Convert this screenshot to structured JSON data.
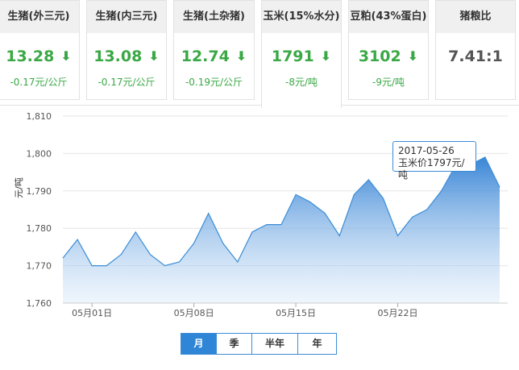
{
  "cards": [
    {
      "name": "生猪(外三元)",
      "value": "13.28",
      "direction": "down",
      "change": "-0.17元/公斤"
    },
    {
      "name": "生猪(内三元)",
      "value": "13.08",
      "direction": "down",
      "change": "-0.17元/公斤"
    },
    {
      "name": "生猪(土杂猪)",
      "value": "12.74",
      "direction": "down",
      "change": "-0.19元/公斤"
    },
    {
      "name": "玉米(15%水分)",
      "value": "1791",
      "direction": "down",
      "change": "-8元/吨"
    },
    {
      "name": "豆粕(43%蛋白)",
      "value": "3102",
      "direction": "down",
      "change": "-9元/吨"
    },
    {
      "name": "猪粮比",
      "value": "7.41:1",
      "direction": "none",
      "change": ""
    }
  ],
  "active_card": 3,
  "arrow_glyph": "⬇",
  "colors": {
    "down": "#3aa845",
    "line": "#3b8dd6",
    "tab_active": "#2f86d6"
  },
  "tooltip": {
    "date": "2017-05-26",
    "text": "玉米价1797元/吨"
  },
  "period_tabs": [
    {
      "label": "月",
      "active": true
    },
    {
      "label": "季",
      "active": false
    },
    {
      "label": "半年",
      "active": false
    },
    {
      "label": "年",
      "active": false
    }
  ],
  "chart_data": {
    "type": "area",
    "ylabel": "元/吨",
    "ylim": [
      1760,
      1810
    ],
    "yticks": [
      "1,760",
      "1,770",
      "1,780",
      "1,790",
      "1,800",
      "1,810"
    ],
    "xticks": [
      {
        "label": "05月01日",
        "date": "2017-05-01"
      },
      {
        "label": "05月08日",
        "date": "2017-05-08"
      },
      {
        "label": "05月15日",
        "date": "2017-05-15"
      },
      {
        "label": "05月22日",
        "date": "2017-05-22"
      }
    ],
    "x": [
      "2017-04-29",
      "2017-04-30",
      "2017-05-01",
      "2017-05-02",
      "2017-05-03",
      "2017-05-04",
      "2017-05-05",
      "2017-05-06",
      "2017-05-07",
      "2017-05-08",
      "2017-05-09",
      "2017-05-10",
      "2017-05-11",
      "2017-05-12",
      "2017-05-13",
      "2017-05-14",
      "2017-05-15",
      "2017-05-16",
      "2017-05-17",
      "2017-05-18",
      "2017-05-19",
      "2017-05-20",
      "2017-05-21",
      "2017-05-22",
      "2017-05-23",
      "2017-05-24",
      "2017-05-25",
      "2017-05-26",
      "2017-05-27",
      "2017-05-28",
      "2017-05-29"
    ],
    "values": [
      1772,
      1777,
      1770,
      1770,
      1773,
      1779,
      1773,
      1770,
      1771,
      1776,
      1784,
      1776,
      1771,
      1779,
      1781,
      1781,
      1789,
      1787,
      1784,
      1778,
      1789,
      1793,
      1788,
      1778,
      1783,
      1785,
      1790,
      1797,
      1797,
      1799,
      1791
    ],
    "highlight_date": "2017-05-26",
    "grid": true
  }
}
